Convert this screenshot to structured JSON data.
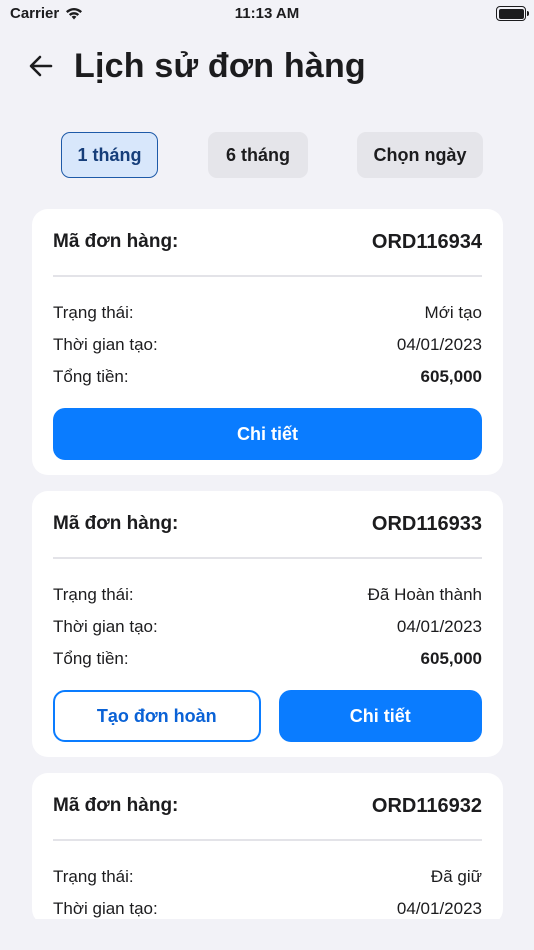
{
  "status_bar": {
    "carrier": "Carrier",
    "time": "11:13 AM"
  },
  "header": {
    "title": "Lịch sử đơn hàng"
  },
  "filters": [
    "1 tháng",
    "6 tháng",
    "Chọn ngày"
  ],
  "labels": {
    "order_code": "Mã đơn hàng:",
    "status": "Trạng thái:",
    "created_time": "Thời gian tạo:",
    "total": "Tổng tiền:"
  },
  "orders": [
    {
      "id": "ORD116934",
      "status": "Mới tạo",
      "created": "04/01/2023",
      "total": "605,000",
      "detail_button": "Chi tiết"
    },
    {
      "id": "ORD116933",
      "status": "Đã Hoàn thành",
      "created": "04/01/2023",
      "total": "605,000",
      "return_button": "Tạo đơn hoàn",
      "detail_button": "Chi tiết"
    },
    {
      "id": "ORD116932",
      "status": "Đã giữ",
      "created": "04/01/2023"
    }
  ],
  "colors": {
    "accent": "#0a7cff",
    "active_filter_bg": "#d8e7fb",
    "background": "#f2f2f7"
  }
}
